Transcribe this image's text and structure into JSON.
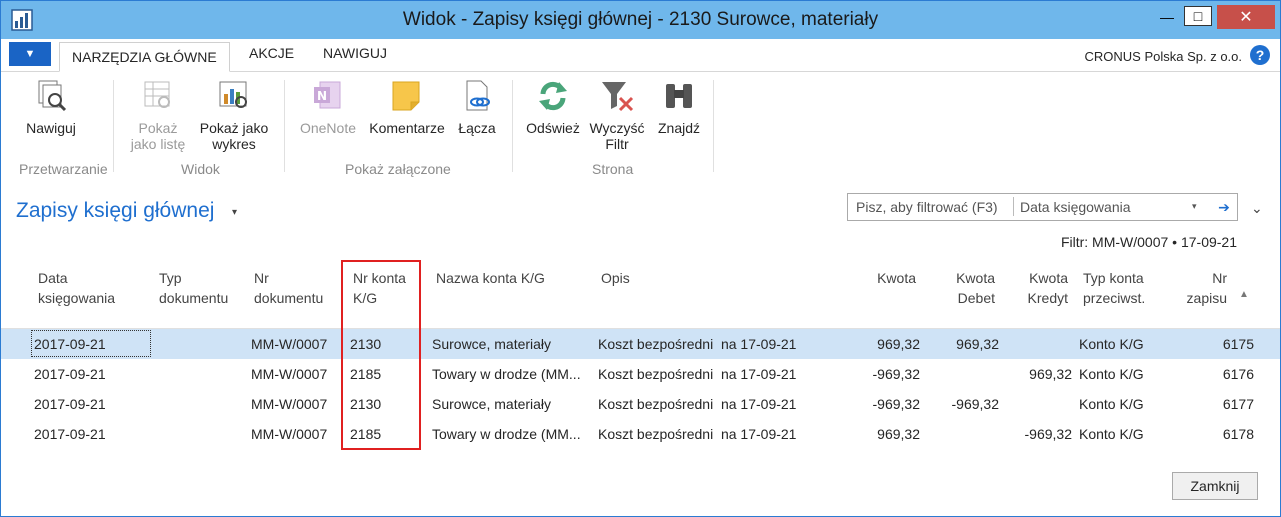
{
  "window": {
    "title": "Widok - Zapisy księgi głównej - 2130 Surowce, materiały",
    "controls": {
      "minimize": "—",
      "maximize": "□",
      "close": "✕"
    }
  },
  "ribbon_tabs": {
    "file_symbol": "▼",
    "tabs": [
      "NARZĘDZIA GŁÓWNE",
      "AKCJE",
      "NAWIGUJ"
    ],
    "company": "CRONUS Polska Sp. z o.o.",
    "help_symbol": "?"
  },
  "ribbon": {
    "buttons": {
      "nawiguj": {
        "label": "Nawiguj",
        "icon": "navigate-icon",
        "enabled": true
      },
      "pokaz_lista": {
        "label1": "Pokaż",
        "label2": "jako listę",
        "icon": "list-view-icon",
        "enabled": false
      },
      "pokaz_wykres": {
        "label1": "Pokaż jako",
        "label2": "wykres",
        "icon": "chart-view-icon",
        "enabled": true
      },
      "onenote": {
        "label": "OneNote",
        "icon": "onenote-icon",
        "enabled": false
      },
      "komentarze": {
        "label": "Komentarze",
        "icon": "comment-note-icon",
        "enabled": true
      },
      "lacza": {
        "label": "Łącza",
        "icon": "links-icon",
        "enabled": true
      },
      "odswiez": {
        "label": "Odśwież",
        "icon": "refresh-icon",
        "enabled": true
      },
      "wyczysc": {
        "label1": "Wyczyść",
        "label2": "Filtr",
        "icon": "clear-filter-icon",
        "enabled": true
      },
      "znajdz": {
        "label": "Znajdź",
        "icon": "binoculars-icon",
        "enabled": true
      }
    },
    "groups": [
      "Przetwarzanie",
      "Widok",
      "Pokaż załączone",
      "Strona"
    ]
  },
  "page": {
    "title": "Zapisy księgi głównej",
    "title_arrow": "▾",
    "filter_placeholder": "Pisz, aby filtrować (F3)",
    "filter_field": "Data księgowania",
    "filter_dropdown": "▾",
    "filter_go": "➔",
    "collapse": "⌄",
    "active_filter": "Filtr: MM-W/0007 • 17-09-21",
    "sort_indicator": "▲"
  },
  "table": {
    "headers": {
      "data": [
        "Data",
        "księgowania"
      ],
      "typ": [
        "Typ",
        "dokumentu"
      ],
      "nr_dok": [
        "Nr",
        "dokumentu"
      ],
      "nr_konta": [
        "Nr konta",
        "K/G"
      ],
      "nazwa": [
        "Nazwa konta K/G"
      ],
      "opis": [
        "Opis"
      ],
      "kwota": [
        "Kwota"
      ],
      "debet": [
        "Kwota",
        "Debet"
      ],
      "kredyt": [
        "Kwota",
        "Kredyt"
      ],
      "typ_konta": [
        "Typ konta",
        "przeciwst."
      ],
      "nr_zapisu": [
        "Nr",
        "zapisu"
      ]
    },
    "rows": [
      {
        "data": "2017-09-21",
        "nr_dok": "MM-W/0007",
        "nr_konta": "2130",
        "nazwa": "Surowce, materiały",
        "opis": "Koszt bezpośredni  na 17-09-21",
        "kwota": "969,32",
        "debet": "969,32",
        "kredyt": "",
        "typ_konta": "Konto K/G",
        "nr_zapisu": "6175"
      },
      {
        "data": "2017-09-21",
        "nr_dok": "MM-W/0007",
        "nr_konta": "2185",
        "nazwa": "Towary w drodze (MM...",
        "opis": "Koszt bezpośredni  na 17-09-21",
        "kwota": "-969,32",
        "debet": "",
        "kredyt": "969,32",
        "typ_konta": "Konto K/G",
        "nr_zapisu": "6176"
      },
      {
        "data": "2017-09-21",
        "nr_dok": "MM-W/0007",
        "nr_konta": "2130",
        "nazwa": "Surowce, materiały",
        "opis": "Koszt bezpośredni  na 17-09-21",
        "kwota": "-969,32",
        "debet": "-969,32",
        "kredyt": "",
        "typ_konta": "Konto K/G",
        "nr_zapisu": "6177"
      },
      {
        "data": "2017-09-21",
        "nr_dok": "MM-W/0007",
        "nr_konta": "2185",
        "nazwa": "Towary w drodze (MM...",
        "opis": "Koszt bezpośredni  na 17-09-21",
        "kwota": "969,32",
        "debet": "",
        "kredyt": "-969,32",
        "typ_konta": "Konto K/G",
        "nr_zapisu": "6178"
      }
    ]
  },
  "footer": {
    "close_label": "Zamknij"
  },
  "colors": {
    "title_bar": "#6fb7eb",
    "accent": "#1f6fcf",
    "selected_row": "#cfe3f6",
    "highlight": "#e02020"
  }
}
